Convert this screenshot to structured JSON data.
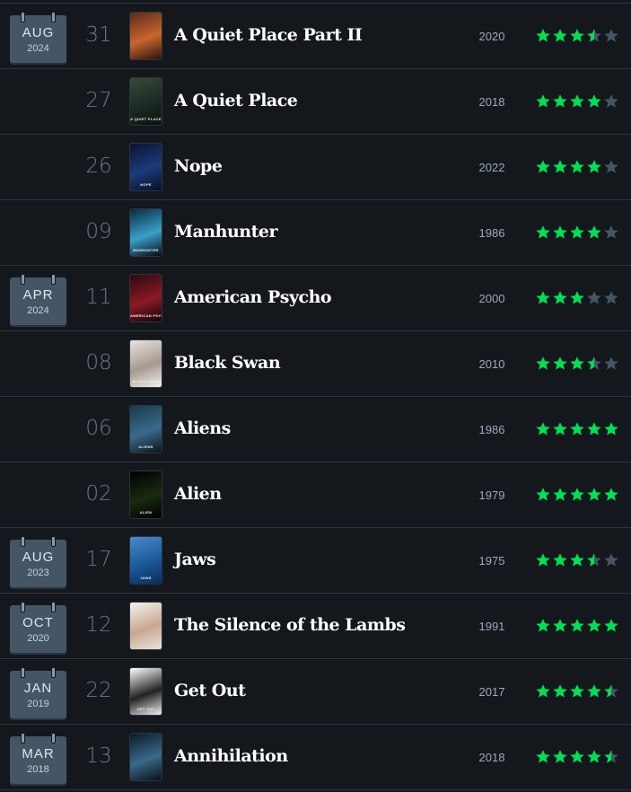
{
  "colors": {
    "background": "#14181c",
    "separator": "#2c3440",
    "calendar_bg": "#445566",
    "star_filled": "#00e054",
    "star_empty": "#445566",
    "title": "#ffffff",
    "day": "#6a7886",
    "release_year": "#99aabb"
  },
  "entries": [
    {
      "month": "AUG",
      "year": "2024",
      "day": "31",
      "title": "A Quiet Place Part II",
      "release_year": "2020",
      "rating": 3.5,
      "poster_icon": "poster-thumbnail",
      "poster_colors": [
        "#5a2a1a",
        "#c8662e",
        "#2a140c"
      ],
      "poster_caption": ""
    },
    {
      "month": "",
      "year": "",
      "day": "27",
      "title": "A Quiet Place",
      "release_year": "2018",
      "rating": 4,
      "poster_icon": "poster-thumbnail",
      "poster_colors": [
        "#3a4a3a",
        "#1c2a24",
        "#0c120e"
      ],
      "poster_caption": "A QUIET PLACE"
    },
    {
      "month": "",
      "year": "",
      "day": "26",
      "title": "Nope",
      "release_year": "2022",
      "rating": 4,
      "poster_icon": "poster-thumbnail",
      "poster_colors": [
        "#0a1430",
        "#1d3a7a",
        "#081028"
      ],
      "poster_caption": "NOPE"
    },
    {
      "month": "",
      "year": "",
      "day": "09",
      "title": "Manhunter",
      "release_year": "1986",
      "rating": 4,
      "poster_icon": "poster-thumbnail",
      "poster_colors": [
        "#0a2a40",
        "#3aa0c8",
        "#050a12"
      ],
      "poster_caption": "MANHUNTER"
    },
    {
      "month": "APR",
      "year": "2024",
      "day": "11",
      "title": "American Psycho",
      "release_year": "2000",
      "rating": 3,
      "poster_icon": "poster-thumbnail",
      "poster_colors": [
        "#2a0a10",
        "#8a1a24",
        "#120408"
      ],
      "poster_caption": "AMERICAN PSYCHO"
    },
    {
      "month": "",
      "year": "",
      "day": "08",
      "title": "Black Swan",
      "release_year": "2010",
      "rating": 3.5,
      "poster_icon": "poster-thumbnail",
      "poster_colors": [
        "#e8e4e0",
        "#a89890",
        "#f4f0ec"
      ],
      "poster_caption": "BLACK SWAN"
    },
    {
      "month": "",
      "year": "",
      "day": "06",
      "title": "Aliens",
      "release_year": "1986",
      "rating": 5,
      "poster_icon": "poster-thumbnail",
      "poster_colors": [
        "#1a3a4a",
        "#3a6a8a",
        "#0a1418"
      ],
      "poster_caption": "ALIENS"
    },
    {
      "month": "",
      "year": "",
      "day": "02",
      "title": "Alien",
      "release_year": "1979",
      "rating": 5,
      "poster_icon": "poster-thumbnail",
      "poster_colors": [
        "#000000",
        "#1a2a10",
        "#000000"
      ],
      "poster_caption": "ALIEN"
    },
    {
      "month": "AUG",
      "year": "2023",
      "day": "17",
      "title": "Jaws",
      "release_year": "1975",
      "rating": 3.5,
      "poster_icon": "poster-thumbnail",
      "poster_colors": [
        "#4a8ac8",
        "#1a5a9a",
        "#0a2a5a"
      ],
      "poster_caption": "JAWS"
    },
    {
      "month": "OCT",
      "year": "2020",
      "day": "12",
      "title": "The Silence of the Lambs",
      "release_year": "1991",
      "rating": 5,
      "poster_icon": "poster-thumbnail",
      "poster_colors": [
        "#f4f2ee",
        "#c8a890",
        "#e8e4dc"
      ],
      "poster_caption": ""
    },
    {
      "month": "JAN",
      "year": "2019",
      "day": "22",
      "title": "Get Out",
      "release_year": "2017",
      "rating": 4.5,
      "poster_icon": "poster-thumbnail",
      "poster_colors": [
        "#ffffff",
        "#222222",
        "#f0f0f0"
      ],
      "poster_caption": "GET OUT"
    },
    {
      "month": "MAR",
      "year": "2018",
      "day": "13",
      "title": "Annihilation",
      "release_year": "2018",
      "rating": 4.5,
      "poster_icon": "poster-thumbnail",
      "poster_colors": [
        "#0a1a2a",
        "#3a6a8a",
        "#081018"
      ],
      "poster_caption": ""
    }
  ]
}
